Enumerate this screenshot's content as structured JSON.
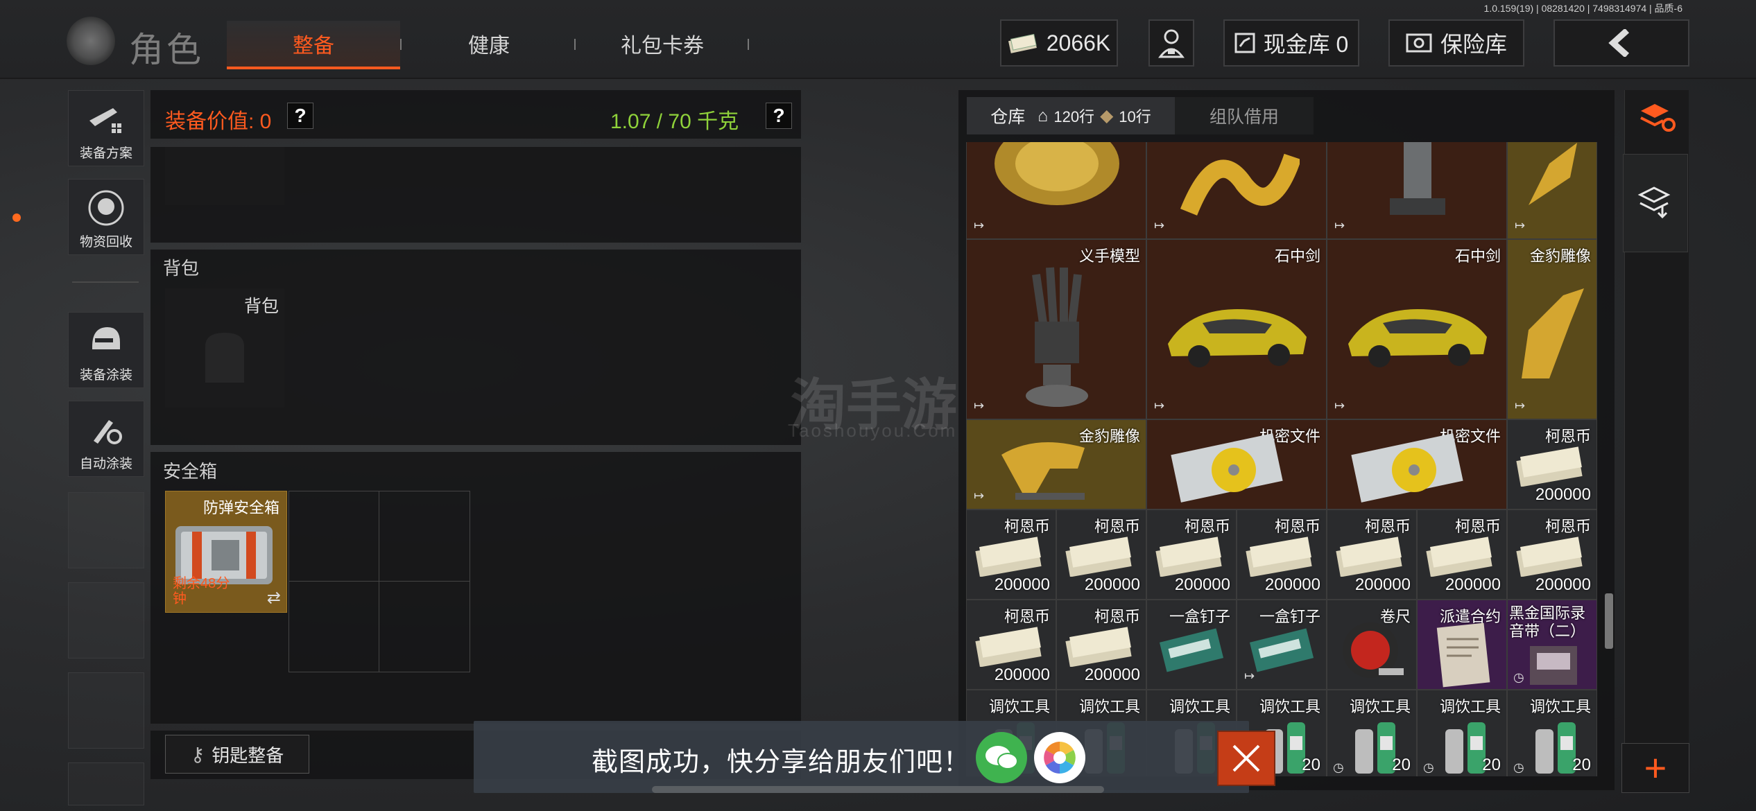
{
  "header": {
    "version": "1.0.159(19) | 08281420 | 7498314974 | 品质-6",
    "title": "角色",
    "tabs": [
      {
        "label": "整备"
      },
      {
        "label": "健康"
      },
      {
        "label": "礼包卡券"
      }
    ],
    "currency": "2066K",
    "cash_vault": "现金库 0",
    "safe_vault": "保险库"
  },
  "left_nav": [
    {
      "label": "装备方案"
    },
    {
      "label": "物资回收"
    },
    {
      "label": "装备涂装"
    },
    {
      "label": "自动涂装"
    }
  ],
  "equipment": {
    "value_label": "装备价值: 0",
    "weight": "1.07 / 70 千克",
    "help": "?",
    "backpack_section": "背包",
    "backpack_slot": "背包",
    "safebox_section": "安全箱",
    "safebox_item_name": "防弹安全箱",
    "safebox_timer": "剩余48分钟",
    "key_button": "钥匙整备"
  },
  "warehouse": {
    "tab_warehouse": "仓库",
    "rows_main": "120行",
    "rows_extra": "10行",
    "tab_team": "组队借用",
    "items": [
      {
        "name": "",
        "count": "",
        "bg": "brown"
      },
      {
        "name": "",
        "count": "",
        "bg": "brown"
      },
      {
        "name": "",
        "count": "",
        "bg": "brown"
      },
      {
        "name": "",
        "count": "",
        "bg": "gold"
      },
      {
        "name": "义手模型",
        "count": "",
        "bg": "brown"
      },
      {
        "name": "石中剑",
        "count": "",
        "bg": "brown"
      },
      {
        "name": "石中剑",
        "count": "",
        "bg": "brown"
      },
      {
        "name": "金豹雕像",
        "count": "",
        "bg": "gold"
      },
      {
        "name": "金豹雕像",
        "count": "",
        "bg": "gold"
      },
      {
        "name": "机密文件",
        "count": "",
        "bg": "brown"
      },
      {
        "name": "机密文件",
        "count": "",
        "bg": "brown"
      },
      {
        "name": "柯恩币",
        "count": "200000",
        "bg": "grey"
      },
      {
        "name": "柯恩币",
        "count": "200000",
        "bg": "grey"
      },
      {
        "name": "柯恩币",
        "count": "200000",
        "bg": "grey"
      },
      {
        "name": "柯恩币",
        "count": "200000",
        "bg": "grey"
      },
      {
        "name": "柯恩币",
        "count": "200000",
        "bg": "grey"
      },
      {
        "name": "柯恩币",
        "count": "200000",
        "bg": "grey"
      },
      {
        "name": "柯恩币",
        "count": "200000",
        "bg": "grey"
      },
      {
        "name": "柯恩币",
        "count": "200000",
        "bg": "grey"
      },
      {
        "name": "柯恩币",
        "count": "200000",
        "bg": "grey"
      },
      {
        "name": "柯恩币",
        "count": "200000",
        "bg": "grey"
      },
      {
        "name": "一盒钉子",
        "count": "",
        "bg": "grey"
      },
      {
        "name": "一盒钉子",
        "count": "",
        "bg": "grey"
      },
      {
        "name": "卷尺",
        "count": "",
        "bg": "grey"
      },
      {
        "name": "派遣合约",
        "count": "",
        "bg": "purple"
      },
      {
        "name": "黑金国际录音带（二）",
        "count": "",
        "bg": "purple"
      },
      {
        "name": "调饮工具",
        "count": "",
        "bg": "grey"
      },
      {
        "name": "调饮工具",
        "count": "",
        "bg": "grey"
      },
      {
        "name": "调饮工具",
        "count": "",
        "bg": "grey"
      },
      {
        "name": "调饮工具",
        "count": "20",
        "bg": "grey"
      },
      {
        "name": "调饮工具",
        "count": "20",
        "bg": "grey"
      },
      {
        "name": "调饮工具",
        "count": "20",
        "bg": "grey"
      },
      {
        "name": "调饮工具",
        "count": "20",
        "bg": "grey"
      }
    ]
  },
  "share": {
    "text": "截图成功，快分享给朋友们吧！"
  },
  "watermark": {
    "cn": "淘手游",
    "en": "Taoshouyou.Com"
  },
  "colors": {
    "accent": "#ff5a1f",
    "weight_green": "#8fd23a"
  }
}
